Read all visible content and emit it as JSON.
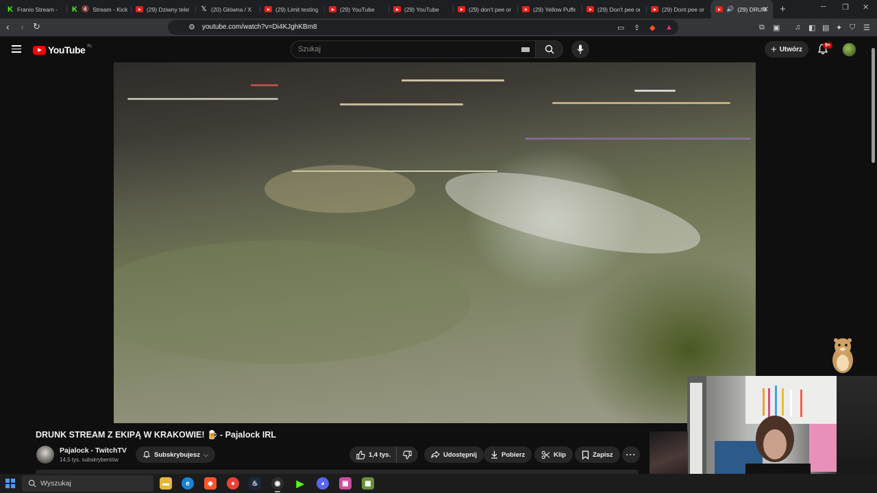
{
  "browser": {
    "tabs": [
      {
        "label": "Franio Stream - Ki",
        "icon": "kick-icon"
      },
      {
        "label": "Stream - Kick",
        "icon": "kick-icon",
        "muted": true
      },
      {
        "label": "(29) Dziwny telef",
        "icon": "youtube-icon"
      },
      {
        "label": "(20) Główna / X",
        "icon": "x-icon"
      },
      {
        "label": "(29) Limit testing",
        "icon": "youtube-icon"
      },
      {
        "label": "(29) YouTube",
        "icon": "youtube-icon"
      },
      {
        "label": "(29) YouTube",
        "icon": "youtube-icon"
      },
      {
        "label": "(29) don't pee or",
        "icon": "youtube-icon"
      },
      {
        "label": "(29) Yellow Puffer",
        "icon": "youtube-icon"
      },
      {
        "label": "(29) Don't pee or",
        "icon": "youtube-icon"
      },
      {
        "label": "(29) Dont pee on",
        "icon": "youtube-icon"
      },
      {
        "label": "(29) DRUN",
        "icon": "youtube-icon",
        "active": true,
        "audio": true
      }
    ],
    "url": "youtube.com/watch?v=Di4KJghKBm8"
  },
  "youtube": {
    "logo_text": "YouTube",
    "region": "PL",
    "search_placeholder": "Szukaj",
    "create_label": "Utwórz",
    "notifications_badge": "9+"
  },
  "video": {
    "title": "DRUNK STREAM Z EKIPĄ W KRAKOWIE! 🍺 - Pajalock IRL",
    "channel_name": "Pajalock - TwitchTV",
    "subscribers": "14,5 tys. subskrybentów",
    "subscribe_label": "Subskrybujesz",
    "likes": "1,4 tys.",
    "share_label": "Udostępnij",
    "download_label": "Pobierz",
    "clip_label": "Klip",
    "save_label": "Zapisz"
  },
  "taskbar": {
    "search_placeholder": "Wyszukaj",
    "apps": [
      "file-explorer-icon",
      "edge-icon",
      "brave-icon",
      "chrome-icon",
      "steam-icon",
      "obs-icon",
      "media-player-icon",
      "discord-icon",
      "app-icon",
      "minecraft-icon"
    ]
  }
}
